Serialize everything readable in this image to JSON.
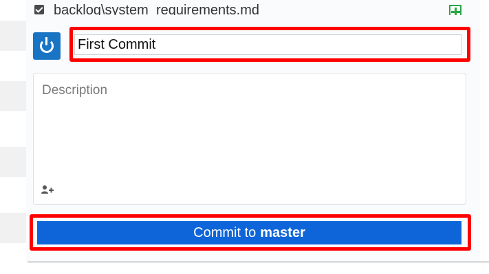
{
  "changed_file": {
    "path": "backlog\\system_requirements.md",
    "checked": true,
    "status_icon": "file-added-icon",
    "status_color": "#28a745"
  },
  "commit": {
    "avatar_icon": "github-power-icon",
    "summary_value": "First Commit",
    "description_placeholder": "Description",
    "description_value": "",
    "coauthor_icon": "add-coauthor-icon",
    "button_prefix": "Commit to",
    "branch": "master",
    "button_color": "#0d65d9"
  },
  "annotations": {
    "highlight_color": "#ff0000"
  }
}
